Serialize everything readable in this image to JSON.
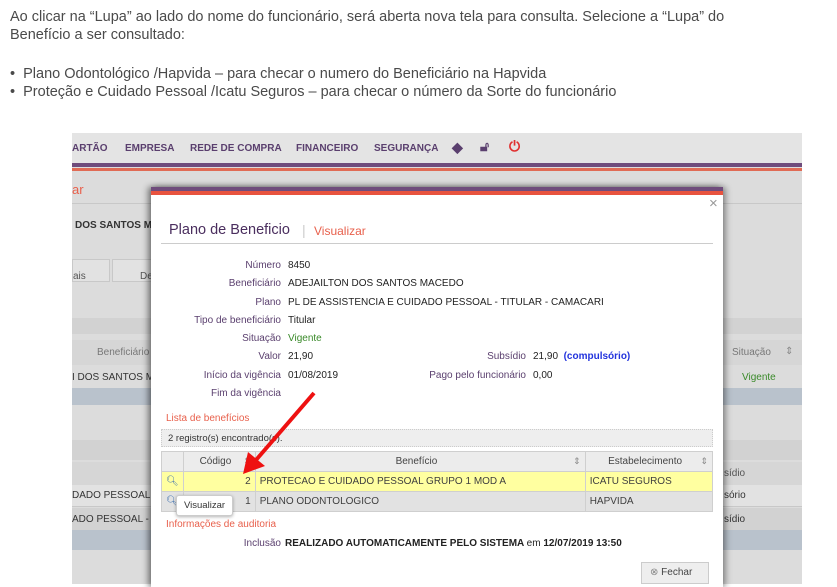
{
  "intro": {
    "line1": "Ao clicar na “Lupa” ao lado do nome do funcionário, será aberta nova tela para consulta. Selecione a “Lupa” do",
    "line2": "Benefício a ser consultado:",
    "bullets": [
      "Plano Odontológico /Hapvida – para checar  o numero  do Beneficiário na  Hapvida",
      "Proteção e Cuidado Pessoal /Icatu  Seguros – para checar  o  número  da Sorte do funcionário"
    ]
  },
  "app": {
    "nav": [
      "ARTÃO",
      "EMPRESA",
      "REDE DE COMPRA",
      "FINANCEIRO",
      "SEGURANÇA"
    ],
    "nav_icons": [
      "tag-icon",
      "unlock-icon",
      "power-icon"
    ],
    "page_title_fragment": "ar",
    "employee_fragment": "DOS SANTOS M",
    "tabs": [
      "ais",
      "De"
    ],
    "table1": {
      "header_beneficiario": "Beneficiário",
      "header_situacao": "Situação",
      "row_name": "I DOS SANTOS M",
      "row_situacao": "Vigente"
    },
    "table2": {
      "header_fragment": "sídio",
      "rows": [
        {
          "left": "DADO PESSOAL -",
          "right": "sório"
        },
        {
          "left": "ADO PESSOAL - D",
          "right": "sídio"
        }
      ]
    }
  },
  "modal": {
    "title": "Plano de Beneficio",
    "separator": "|",
    "subtitle": "Visualizar",
    "close": "×",
    "fields": [
      {
        "label": "Número",
        "value": "8450"
      },
      {
        "label": "Beneficiário",
        "value": "ADEJAILTON DOS SANTOS MACEDO"
      },
      {
        "label": "Plano",
        "value": "PL DE ASSISTENCIA E CUIDADO PESSOAL - TITULAR - CAMACARI"
      },
      {
        "label": "Tipo de beneficiário",
        "value": "Titular"
      },
      {
        "label": "Situação",
        "value": "Vigente"
      },
      {
        "label": "Valor",
        "value": "21,90"
      },
      {
        "label": "Início da vigência",
        "value": "01/08/2019"
      },
      {
        "label": "Fim da vigência",
        "value": ""
      }
    ],
    "subsidio": {
      "label": "Subsídio",
      "value": "21,90",
      "note": "(compulsório)"
    },
    "pago": {
      "label": "Pago pelo funcionário",
      "value": "0,00"
    },
    "list_title": "Lista de benefícios",
    "records": "2 registro(s) encontrado(s).",
    "columns": [
      "Código",
      "Benefício",
      "Estabelecimento"
    ],
    "rows": [
      {
        "codigo": "2",
        "beneficio": "PROTECAO E CUIDADO PESSOAL GRUPO 1 MOD A",
        "estabelecimento": "ICATU SEGUROS"
      },
      {
        "codigo": "1",
        "beneficio": "PLANO ODONTOLOGICO",
        "estabelecimento": "HAPVIDA"
      }
    ],
    "tooltip": "Visualizar",
    "audit_title": "Informações de auditoria",
    "inclusao": {
      "label": "Inclusão",
      "value": "REALIZADO AUTOMATICAMENTE PELO SISTEMA",
      "em": "em",
      "date": "12/07/2019 13:50"
    },
    "close_button": "Fechar"
  },
  "colors": {
    "purple": "#6f4c7c",
    "accent": "#e8604c",
    "highlight_row": "#ffffa0",
    "arrow": "#ee1111"
  }
}
